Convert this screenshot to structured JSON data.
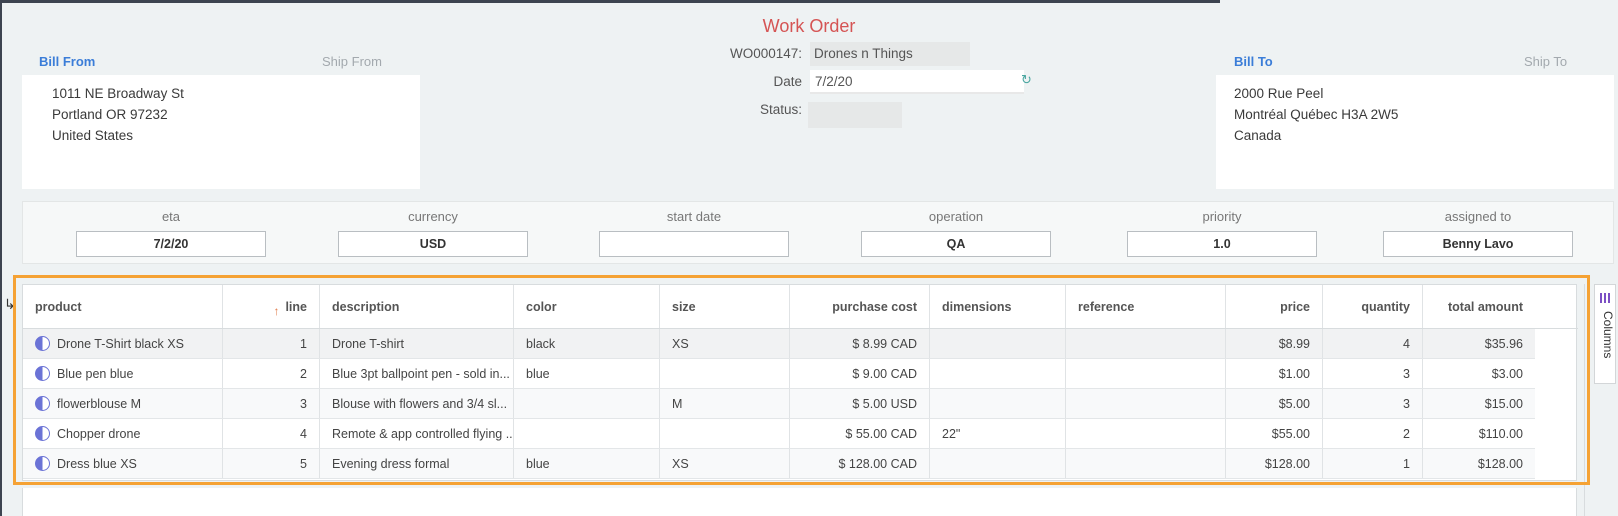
{
  "title": "Work Order",
  "bill_from": {
    "tab_active": "Bill From",
    "tab_inactive": "Ship From",
    "lines": [
      "1011 NE Broadway St",
      "Portland OR 97232",
      "United States"
    ]
  },
  "bill_to": {
    "tab_active": "Bill To",
    "tab_inactive": "Ship To",
    "lines": [
      "2000 Rue Peel",
      "Montréal Québec H3A 2W5",
      "Canada"
    ]
  },
  "order": {
    "number_label": "WO000147:",
    "company": "Drones n Things",
    "date_label": "Date",
    "date_value": "7/2/20",
    "status_label": "Status:",
    "status_value": ""
  },
  "info": [
    {
      "label": "eta",
      "value": "7/2/20"
    },
    {
      "label": "currency",
      "value": "USD"
    },
    {
      "label": "start date",
      "value": ""
    },
    {
      "label": "operation",
      "value": "QA"
    },
    {
      "label": "priority",
      "value": "1.0"
    },
    {
      "label": "assigned to",
      "value": "Benny Lavo"
    }
  ],
  "grid": {
    "sort_icon": "sort-up-arrow",
    "columns": [
      "product",
      "line",
      "description",
      "color",
      "size",
      "purchase cost",
      "dimensions",
      "reference",
      "price",
      "quantity",
      "total amount"
    ],
    "rows": [
      [
        "Drone T-Shirt black XS",
        "1",
        "Drone T-shirt",
        "black",
        "XS",
        "$ 8.99 CAD",
        "",
        "",
        "$8.99",
        "4",
        "$35.96"
      ],
      [
        "Blue pen blue",
        "2",
        "Blue 3pt ballpoint pen - sold in...",
        "blue",
        "",
        "$ 9.00 CAD",
        "",
        "",
        "$1.00",
        "3",
        "$3.00"
      ],
      [
        "flowerblouse M",
        "3",
        "Blouse with flowers and 3/4 sl...",
        "",
        "M",
        "$ 5.00 USD",
        "",
        "",
        "$5.00",
        "3",
        "$15.00"
      ],
      [
        "Chopper drone",
        "4",
        "Remote & app controlled flying ...",
        "",
        "",
        "$ 55.00 CAD",
        "22\"",
        "",
        "$55.00",
        "2",
        "$110.00"
      ],
      [
        "Dress blue XS",
        "5",
        "Evening dress formal",
        "blue",
        "XS",
        "$ 128.00 CAD",
        "",
        "",
        "$128.00",
        "1",
        "$128.00"
      ]
    ]
  },
  "columns_panel": {
    "label": "Columns",
    "icon": "columns-icon"
  },
  "colors": {
    "accent_blue": "#3b7dd8",
    "title_red": "#d55454",
    "highlight_orange": "#f5a234"
  }
}
